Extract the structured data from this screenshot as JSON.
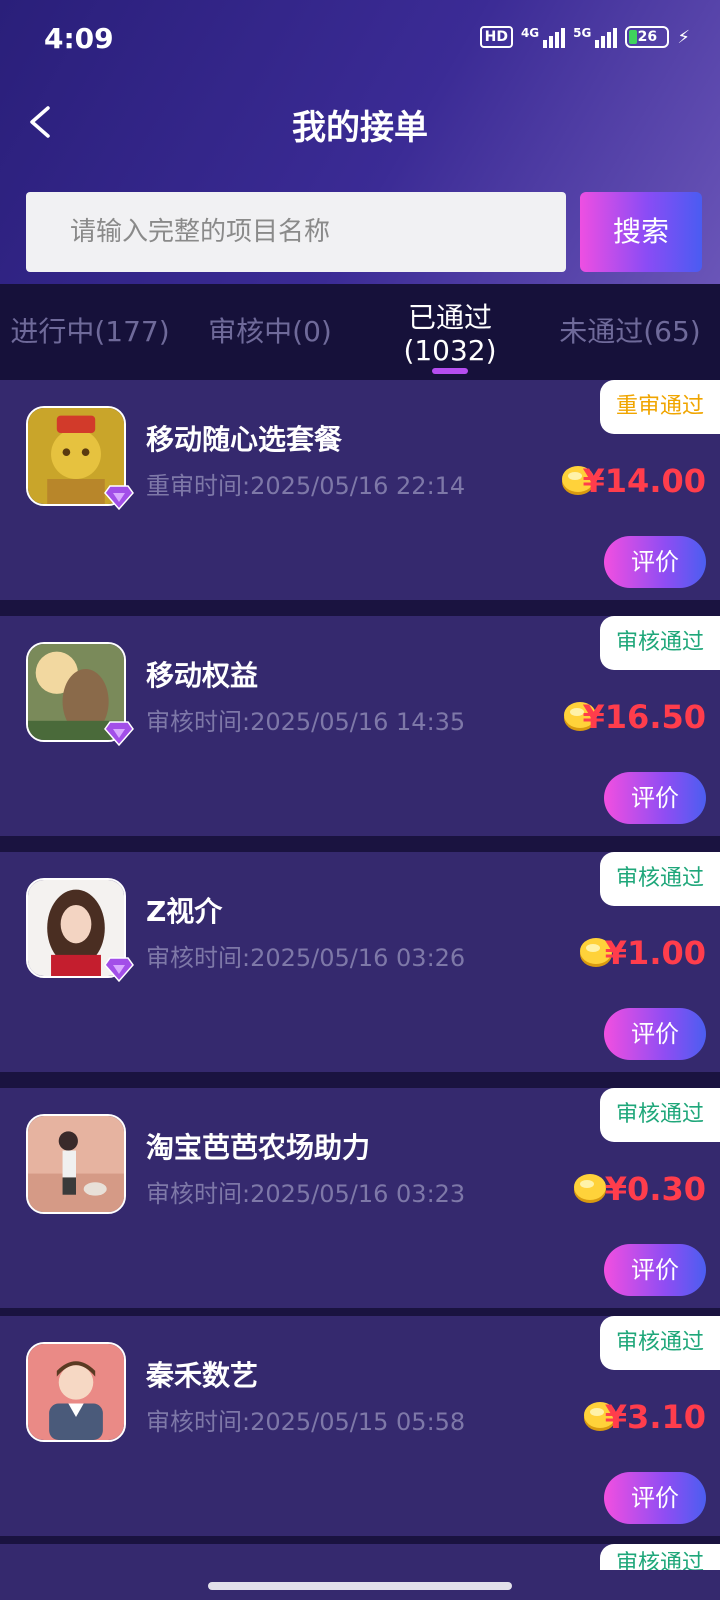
{
  "status_bar": {
    "time": "4:09",
    "hd": "HD",
    "net1": "4G",
    "net2": "5G",
    "battery": "26"
  },
  "header": {
    "title": "我的接单"
  },
  "search": {
    "placeholder": "请输入完整的项目名称",
    "button_label": "搜索"
  },
  "tabs": [
    {
      "label": "进行中(177)"
    },
    {
      "label": "审核中(0)"
    },
    {
      "label_line1": "已通过",
      "label_line2": "(1032)",
      "active": true
    },
    {
      "label": "未通过(65)"
    }
  ],
  "orders": [
    {
      "name": "移动随心选套餐",
      "time": "重审时间:2025/05/16 22:14",
      "status": "重审通过",
      "status_color": "#f0a500",
      "price": "¥14.00",
      "button": "评价"
    },
    {
      "name": "移动权益",
      "time": "审核时间:2025/05/16 14:35",
      "status": "审核通过",
      "status_color": "#1fa77a",
      "price": "¥16.50",
      "button": "评价"
    },
    {
      "name": "Z视介",
      "time": "审核时间:2025/05/16 03:26",
      "status": "审核通过",
      "status_color": "#1fa77a",
      "price": "¥1.00",
      "button": "评价"
    },
    {
      "name": "淘宝芭芭农场助力",
      "time": "审核时间:2025/05/16 03:23",
      "status": "审核通过",
      "status_color": "#1fa77a",
      "price": "¥0.30",
      "button": "评价"
    },
    {
      "name": "秦禾数艺",
      "time": "审核时间:2025/05/15 05:58",
      "status": "审核通过",
      "status_color": "#1fa77a",
      "price": "¥3.10",
      "button": "评价"
    }
  ],
  "peek": {
    "status": "审核通过"
  },
  "colors": {
    "accent_gradient_start": "#f24fe0",
    "accent_gradient_end": "#4b5ef0",
    "price_red": "#ff3d4c",
    "card_bg": "#35296e"
  }
}
